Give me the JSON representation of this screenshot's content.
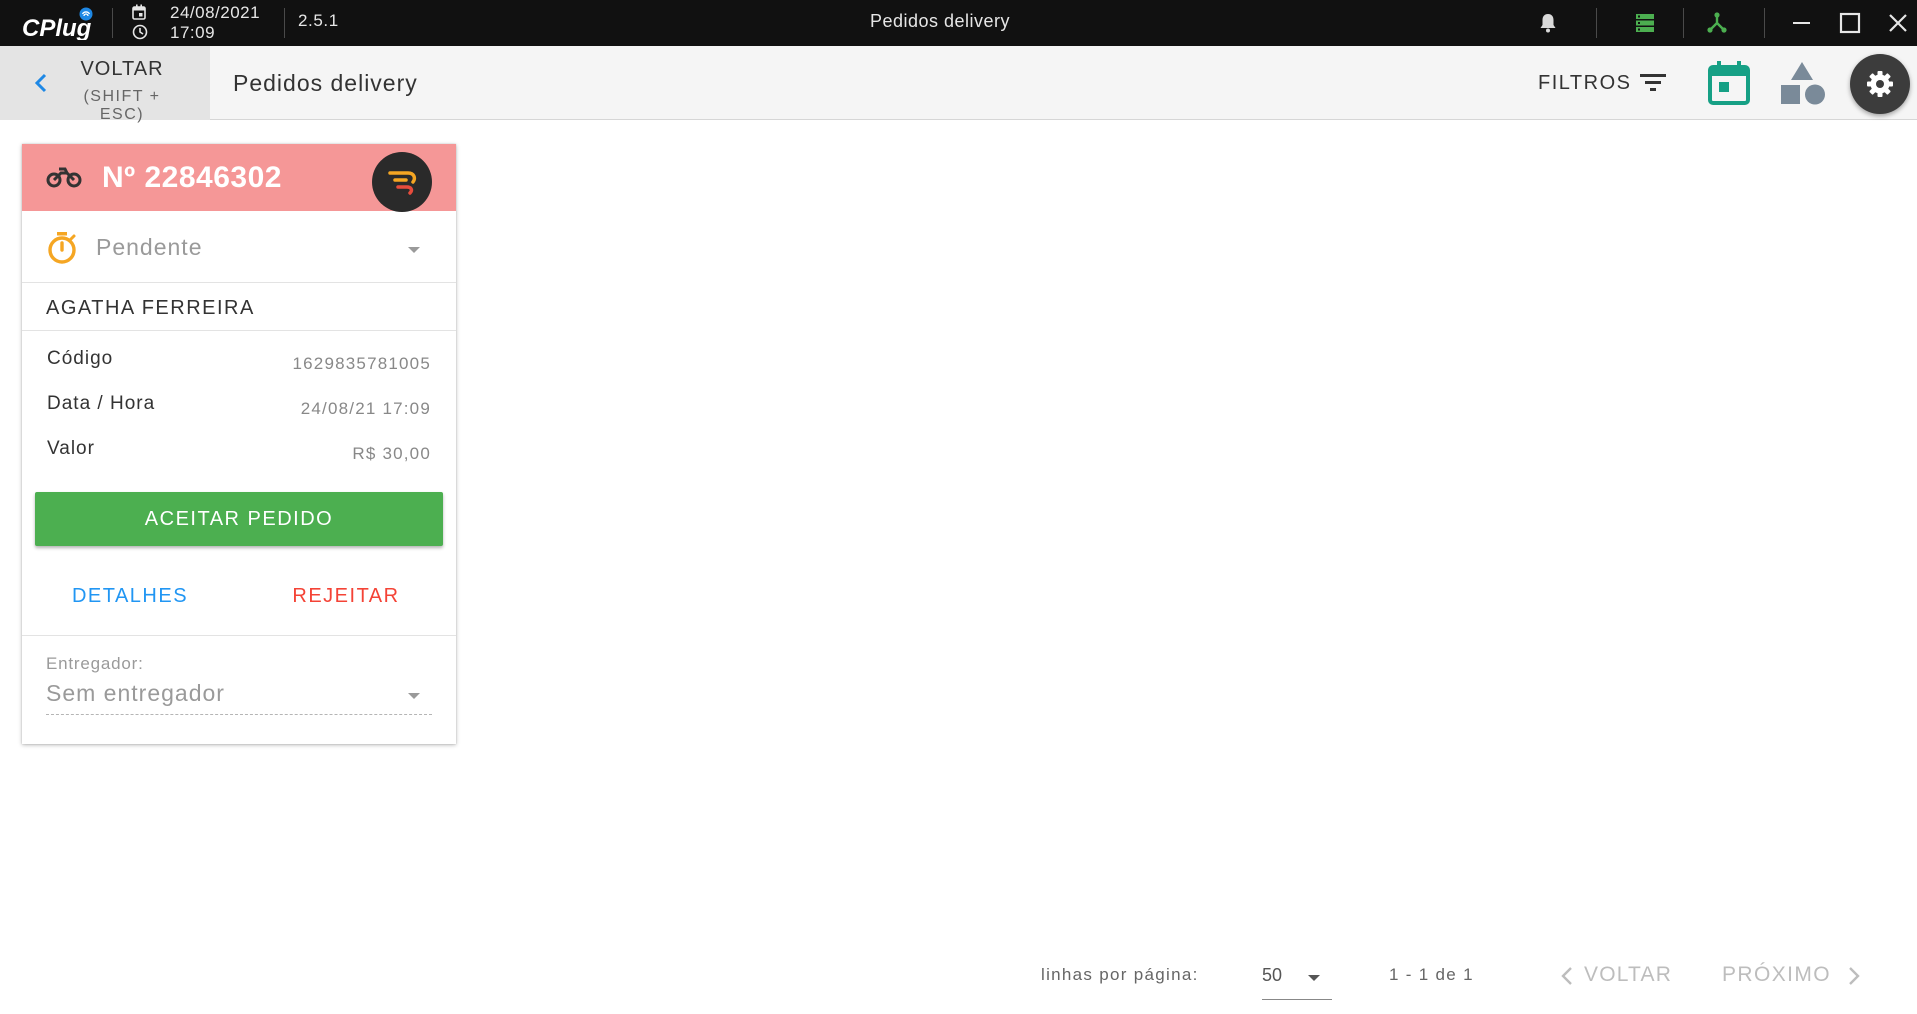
{
  "titlebar": {
    "logo_text": "CPlug",
    "date": "24/08/2021",
    "time": "17:09",
    "version": "2.5.1",
    "window_title": "Pedidos delivery",
    "icons": [
      "bell-icon",
      "server-icon",
      "network-icon",
      "minimize-icon",
      "maximize-icon",
      "close-icon"
    ],
    "colors": {
      "background": "#111111",
      "status_green": "#4caf50",
      "logo_blue": "#1e88e5"
    }
  },
  "header": {
    "back_label": "VOLTAR",
    "back_shortcut": "(SHIFT + ESC)",
    "title": "Pedidos delivery",
    "filters_label": "FILTROS",
    "icons": [
      "chevron-left-icon",
      "filter-icon",
      "calendar-icon",
      "shapes-icon",
      "gear-icon"
    ],
    "colors": {
      "calendar": "#16a085",
      "shapes": "#7a8a99",
      "back_chevron": "#1e88e5"
    }
  },
  "order": {
    "number": "Nº 22846302",
    "header_color": "#f59797",
    "status": "Pendente",
    "status_icon": "timer-icon",
    "status_icon_color": "#f5a623",
    "customer": "AGATHA FERREIRA",
    "details": [
      {
        "label": "Código",
        "value": "1629835781005"
      },
      {
        "label": "Data / Hora",
        "value": "24/08/21 17:09"
      },
      {
        "label": "Valor",
        "value": "R$ 30,00"
      }
    ],
    "accept_label": "ACEITAR PEDIDO",
    "accept_color": "#4caf50",
    "details_label": "DETALHES",
    "reject_label": "REJEITAR",
    "courier_label": "Entregador:",
    "courier_value": "Sem entregador"
  },
  "pagination": {
    "rows_label": "linhas por página:",
    "rows_value": "50",
    "range": "1 - 1 de 1",
    "prev_label": "VOLTAR",
    "next_label": "PRÓXIMO"
  }
}
